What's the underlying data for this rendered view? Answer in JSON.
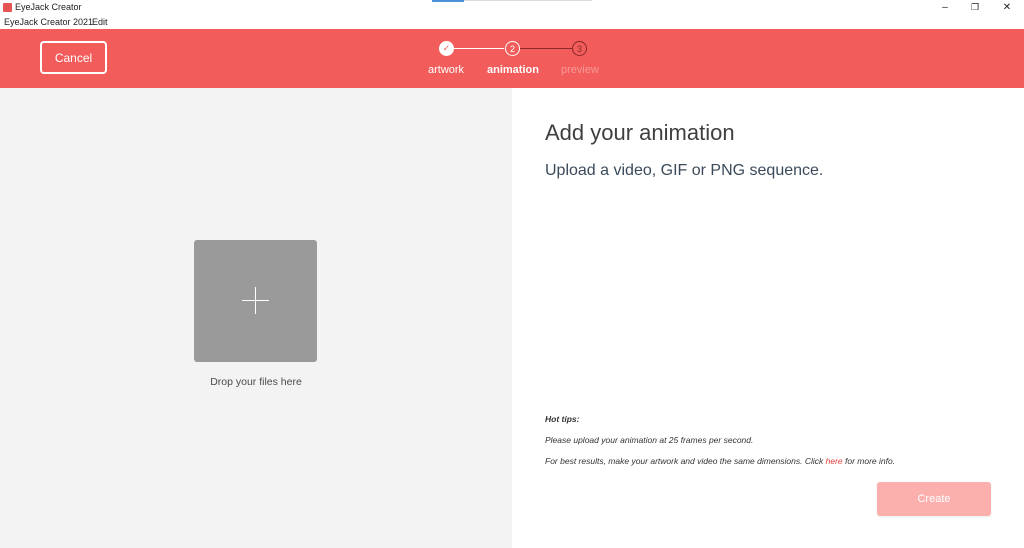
{
  "window": {
    "title": "EyeJack Creator",
    "controls": {
      "minimize": "–",
      "restore": "❐",
      "close": "✕"
    }
  },
  "menu": {
    "items": [
      "EyeJack Creator 2021",
      "Edit"
    ]
  },
  "header": {
    "background": "#f25c5a",
    "cancel_label": "Cancel",
    "steps": [
      {
        "label": "artwork",
        "state": "done",
        "marker": "✓"
      },
      {
        "label": "animation",
        "state": "active",
        "marker": "2"
      },
      {
        "label": "preview",
        "state": "pending",
        "marker": "3"
      }
    ]
  },
  "left": {
    "drop_icon": "plus-icon",
    "drop_label": "Drop your files here"
  },
  "right": {
    "heading": "Add your animation",
    "subheading": "Upload a video, GIF or PNG sequence.",
    "tips_title": "Hot tips:",
    "tip1": "Please upload your animation at 25 frames per second.",
    "tip2_before": "For best results, make your artwork and video the same dimensions. Click ",
    "tip2_link": "here",
    "tip2_after": " for more info.",
    "create_label": "Create",
    "link_color": "#e53935"
  }
}
